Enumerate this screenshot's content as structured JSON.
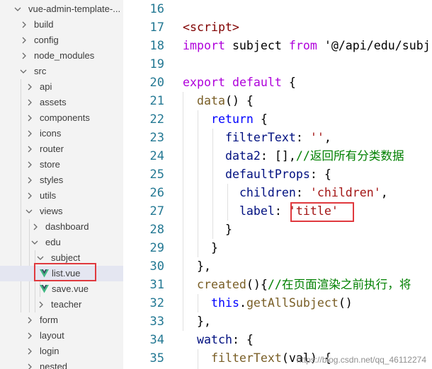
{
  "explorer": {
    "items": [
      {
        "label": "vue-admin-template-...",
        "type": "folder-open"
      },
      {
        "label": "build",
        "type": "folder"
      },
      {
        "label": "config",
        "type": "folder"
      },
      {
        "label": "node_modules",
        "type": "folder"
      },
      {
        "label": "src",
        "type": "folder-open"
      },
      {
        "label": "api",
        "type": "folder"
      },
      {
        "label": "assets",
        "type": "folder"
      },
      {
        "label": "components",
        "type": "folder"
      },
      {
        "label": "icons",
        "type": "folder"
      },
      {
        "label": "router",
        "type": "folder"
      },
      {
        "label": "store",
        "type": "folder"
      },
      {
        "label": "styles",
        "type": "folder"
      },
      {
        "label": "utils",
        "type": "folder"
      },
      {
        "label": "views",
        "type": "folder-open"
      },
      {
        "label": "dashboard",
        "type": "folder"
      },
      {
        "label": "edu",
        "type": "folder-open"
      },
      {
        "label": "subject",
        "type": "folder-open"
      },
      {
        "label": "list.vue",
        "type": "vue-file"
      },
      {
        "label": "save.vue",
        "type": "vue-file"
      },
      {
        "label": "teacher",
        "type": "folder"
      },
      {
        "label": "form",
        "type": "folder"
      },
      {
        "label": "layout",
        "type": "folder"
      },
      {
        "label": "login",
        "type": "folder"
      },
      {
        "label": "nested",
        "type": "folder"
      }
    ],
    "vue_icon_color": "#41b883"
  },
  "editor": {
    "lines": [
      {
        "num": "16",
        "text": ""
      },
      {
        "num": "17",
        "text": "<script>"
      },
      {
        "num": "18",
        "text": "import subject from '@/api/edu/subj"
      },
      {
        "num": "19",
        "text": ""
      },
      {
        "num": "20",
        "text": "export default {"
      },
      {
        "num": "21",
        "text": "  data() {"
      },
      {
        "num": "22",
        "text": "    return {"
      },
      {
        "num": "23",
        "text": "      filterText: '',"
      },
      {
        "num": "24",
        "text": "      data2: [],//返回所有分类数据"
      },
      {
        "num": "25",
        "text": "      defaultProps: {"
      },
      {
        "num": "26",
        "text": "        children: 'children',"
      },
      {
        "num": "27",
        "text": "        label: 'title'"
      },
      {
        "num": "28",
        "text": "      }"
      },
      {
        "num": "29",
        "text": "    }"
      },
      {
        "num": "30",
        "text": "  },"
      },
      {
        "num": "31",
        "text": "  created(){//在页面渲染之前执行，将"
      },
      {
        "num": "32",
        "text": "    this.getAllSubject()"
      },
      {
        "num": "33",
        "text": "  },"
      },
      {
        "num": "34",
        "text": "  watch: {"
      },
      {
        "num": "35",
        "text": "    filterText(val) {"
      }
    ],
    "watermark": "https://blog.csdn.net/qq_46112274"
  },
  "colors": {
    "highlight_box": "#e0393e",
    "line_number": "#237893",
    "keyword": "#0000ff",
    "string": "#a31515",
    "comment": "#008000"
  }
}
